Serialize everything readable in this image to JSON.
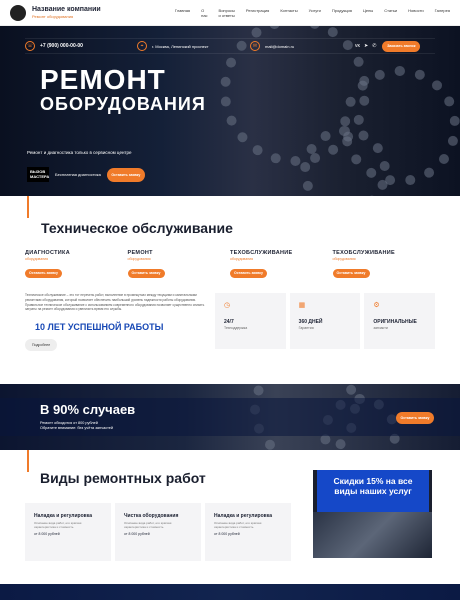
{
  "nav": {
    "company": "Название компании",
    "tagline": "Ремонт оборудования",
    "menu": [
      "Главная",
      "О нас",
      "Вопросы и ответы",
      "Регистрация",
      "Контакты",
      "Услуги",
      "Продукция",
      "Цены",
      "Статьи",
      "Новости",
      "Галерея"
    ]
  },
  "hero": {
    "phone": "+7 (900) 000-00-00",
    "address": "г. Москва, Ленинский проспект",
    "email": "mail@domain.ru",
    "socials": [
      "vk",
      "telegram",
      "whatsapp"
    ],
    "top_button": "Заказать звонок",
    "title_line1": "РЕМОНТ",
    "title_line2": "ОБОРУДОВАНИЯ",
    "subtitle": "Ремонт и диагностика только в сервисном центре",
    "badge": "ВЫЗОВ МАСТЕРА",
    "free_diag": "Бесплатная диагностика",
    "cta_button": "Оставить заявку"
  },
  "maintenance": {
    "title": "Техническое обслуживание",
    "services": [
      {
        "name": "ДИАГНОСТИКА",
        "sub": "оборудования",
        "button": "Оставить заявку"
      },
      {
        "name": "РЕМОНТ",
        "sub": "оборудования",
        "button": "Оставить заявку"
      },
      {
        "name": "ТЕХОБСЛУЖИВАНИЕ",
        "sub": "оборудования",
        "button": "Оставить заявку"
      },
      {
        "name": "ТЕХОБСЛУЖИВАНИЕ",
        "sub": "оборудования",
        "button": "Оставить заявку"
      }
    ],
    "paragraph": "Техническое обслуживание – это тот перечень работ, выполнение в промежутках между текущими и капитальными ремонтами оборудования, который позволяет обеспечить наибольший уровень надежности работы оборудования. Правильное техническое обслуживание с использованием современного оборудования позволяет существенно снизить затраты на ремонт оборудования и увеличить время его службы.",
    "years": "10 ЛЕТ УСПЕШНОЙ РАБОТЫ",
    "more_button": "Подробнее",
    "stats": [
      {
        "icon": "clock-icon",
        "glyph": "◷",
        "value": "24/7",
        "label": "Техподдержка"
      },
      {
        "icon": "calendar-icon",
        "glyph": "▦",
        "value": "360 ДНЕЙ",
        "label": "Гарантия"
      },
      {
        "icon": "gear-icon",
        "glyph": "⚙",
        "value": "ОРИГИНАЛЬНЫЕ",
        "label": "запчасти"
      }
    ]
  },
  "banner": {
    "title": "В 90% случаев",
    "sub1": "Ремонт обходится от 800 рублей",
    "sub2": "Обратите внимание: без учёта запчастей",
    "button": "Оставить заявку"
  },
  "repairs": {
    "title": "Виды ремонтных работ",
    "cards": [
      {
        "title": "Наладка и регулировка",
        "desc": "Описание вида работ, его краткая характеристика и стоимость",
        "price": "от 8 000 рублей"
      },
      {
        "title": "Чистка оборудования",
        "desc": "Описание вида работ, его краткая характеристика и стоимость",
        "price": "от 8 000 рублей"
      },
      {
        "title": "Наладка и регулировка",
        "desc": "Описание вида работ, его краткая характеристика и стоимость",
        "price": "от 8 000 рублей"
      }
    ],
    "promo": "Скидки 15% на все виды наших услуг"
  },
  "colors": {
    "accent": "#f07b2a",
    "blue": "#1548c8",
    "dark": "#1a1f2e"
  }
}
